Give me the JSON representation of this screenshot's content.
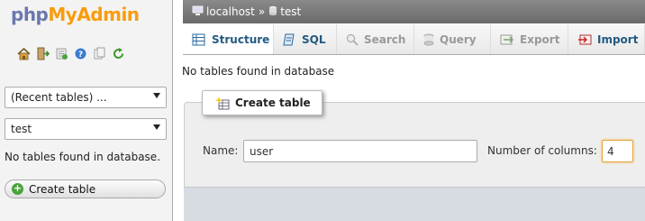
{
  "left": {
    "logo": {
      "part1": "php",
      "part2": "MyAdmin"
    },
    "quick_icons": [
      "home-icon",
      "logout-icon",
      "sql-query-icon",
      "help-icon",
      "docs-icon",
      "reload-icon"
    ],
    "recent_tables": "(Recent tables) ...",
    "database_select": "test",
    "no_tables_text": "No tables found in database.",
    "create_table_button": "Create table"
  },
  "breadcrumb": {
    "server": "localhost",
    "separator": "»",
    "database": "test"
  },
  "tabs": [
    {
      "label": "Structure",
      "icon": "structure-icon",
      "state": "active"
    },
    {
      "label": "SQL",
      "icon": "sql-icon",
      "state": "normal"
    },
    {
      "label": "Search",
      "icon": "search-icon",
      "state": "disabled"
    },
    {
      "label": "Query",
      "icon": "query-icon",
      "state": "disabled"
    },
    {
      "label": "Export",
      "icon": "export-icon",
      "state": "disabled"
    },
    {
      "label": "Import",
      "icon": "import-icon",
      "state": "normal"
    }
  ],
  "main": {
    "no_tables_text": "No tables found in database",
    "create_table_legend": "Create table",
    "name_label": "Name:",
    "name_value": "user",
    "columns_label": "Number of columns:",
    "columns_value": "4"
  },
  "colors": {
    "accent_orange": "#f89c0e",
    "logo_blue": "#6c78af",
    "tab_text": "#235a81"
  }
}
